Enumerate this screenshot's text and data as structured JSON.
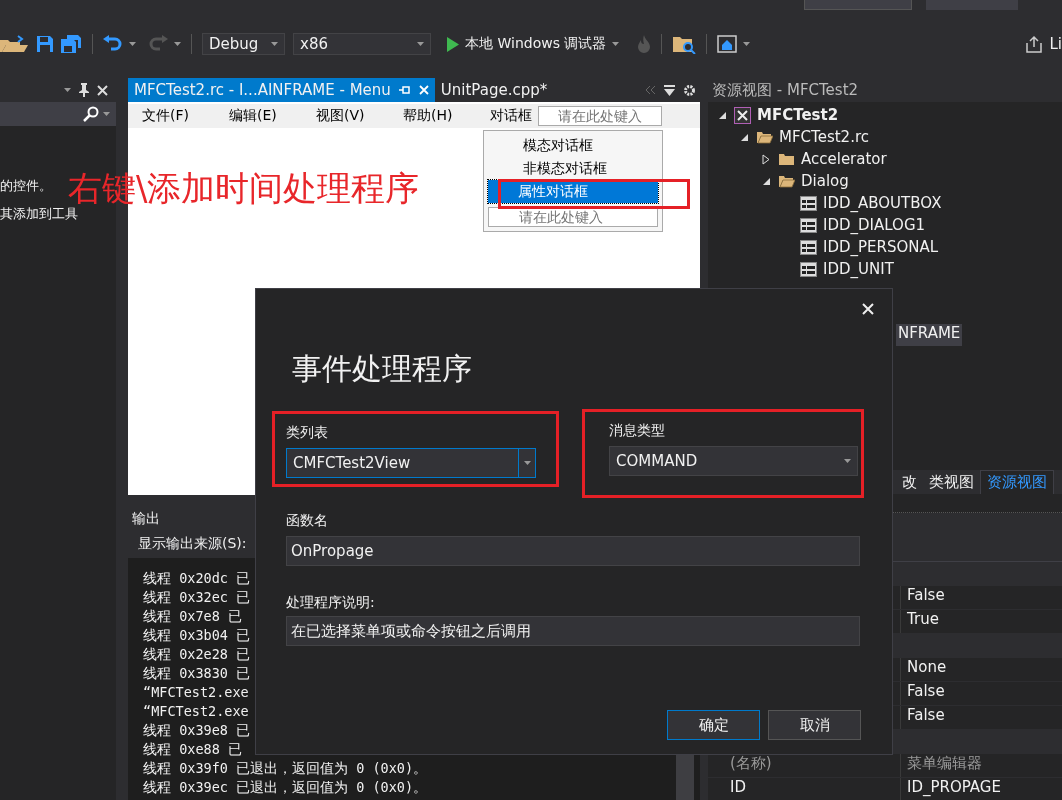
{
  "toolbar": {
    "configuration": "Debug",
    "platform": "x86",
    "debugger": "本地 Windows 调试器",
    "share_label": "Li"
  },
  "left_panel": {
    "text_lines": [
      "的控件。",
      "其添加到工具"
    ]
  },
  "editor": {
    "tabs": [
      {
        "label": "MFCTest2.rc - I...AINFRAME - Menu",
        "selected": true
      },
      {
        "label": "UnitPage.cpp*",
        "selected": false
      }
    ],
    "menu_bar": [
      {
        "label": "文件(F)"
      },
      {
        "label": "编辑(E)"
      },
      {
        "label": "视图(V)"
      },
      {
        "label": "帮助(H)"
      },
      {
        "label": "对话框"
      }
    ],
    "menu_bar_placeholder": "请在此处键入",
    "dropdown": [
      {
        "label": "模态对话框",
        "selected": false
      },
      {
        "label": "非模态对话框",
        "selected": false
      },
      {
        "label": "属性对话框",
        "selected": true
      }
    ],
    "dropdown_placeholder": "请在此处键入"
  },
  "annotation": "右键\\添加时间处理程序",
  "output": {
    "title": "输出",
    "source_label": "显示输出来源(S):",
    "lines": [
      "线程 0x20dc 已",
      "线程 0x32ec 已",
      "线程 0x7e8 已",
      "线程 0x3b04 已",
      "线程 0x2e28 已",
      "线程 0x3830 已",
      "“MFCTest2.exe",
      "“MFCTest2.exe",
      "线程 0x39e8 已",
      "线程 0xe88 已",
      "线程 0x39f0 已退出，返回值为 0 (0x0)。",
      "线程 0x39ec 已退出，返回值为 0 (0x0)。"
    ]
  },
  "resource_view": {
    "title": "资源视图 - MFCTest2",
    "tree": [
      {
        "label": "MFCTest2",
        "kind": "project",
        "expanded": true,
        "children": [
          {
            "label": "MFCTest2.rc",
            "kind": "folder",
            "expanded": true,
            "children": [
              {
                "label": "Accelerator",
                "kind": "folder",
                "expanded": false
              },
              {
                "label": "Dialog",
                "kind": "folder",
                "expanded": true,
                "children": [
                  {
                    "label": "IDD_ABOUTBOX",
                    "kind": "dialog"
                  },
                  {
                    "label": "IDD_DIALOG1",
                    "kind": "dialog"
                  },
                  {
                    "label": "IDD_PERSONAL",
                    "kind": "dialog"
                  },
                  {
                    "label": "IDD_UNIT",
                    "kind": "dialog"
                  }
                ]
              }
            ]
          }
        ]
      }
    ],
    "cut_row": {
      "label": "NFRAME",
      "selected": true
    },
    "tabs": [
      {
        "label": "改",
        "selected": false
      },
      {
        "label": "类视图",
        "selected": false
      },
      {
        "label": "资源视图",
        "selected": true
      }
    ]
  },
  "properties": {
    "rows": [
      {
        "kind": "category"
      },
      {
        "kind": "value",
        "value": "False"
      },
      {
        "kind": "value",
        "value": "True"
      },
      {
        "kind": "category"
      },
      {
        "kind": "value",
        "value": "None"
      },
      {
        "kind": "value",
        "value": "False"
      },
      {
        "kind": "value",
        "value": "False"
      },
      {
        "kind": "category"
      },
      {
        "kind": "named",
        "name": "(名称)",
        "value": "菜单编辑器",
        "disabled": true
      },
      {
        "kind": "named",
        "name": "ID",
        "value": "ID_PROPAGE",
        "disabled": false
      }
    ]
  },
  "dialog": {
    "title": "事件处理程序",
    "class_list": {
      "label": "类列表",
      "value": "CMFCTest2View",
      "focused": true
    },
    "message_type": {
      "label": "消息类型",
      "value": "COMMAND",
      "focused": false
    },
    "function_name": {
      "label": "函数名",
      "value": "OnPropage"
    },
    "description": {
      "label": "处理程序说明:",
      "value": "在已选择菜单项或命令按钮之后调用"
    },
    "buttons": [
      {
        "label": "确定",
        "default": true
      },
      {
        "label": "取消",
        "default": false
      }
    ]
  }
}
